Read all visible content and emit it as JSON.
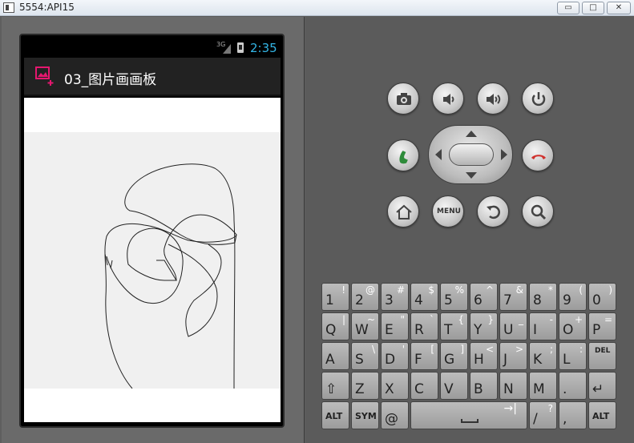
{
  "window": {
    "title": "5554:API15",
    "minimize": "▭",
    "maximize": "□",
    "close": "✕"
  },
  "statusbar": {
    "network": "3G",
    "time": "2:35"
  },
  "app": {
    "title": "03_图片画画板"
  },
  "keyboard": {
    "rows": [
      [
        {
          "m": "1",
          "a": "!"
        },
        {
          "m": "2",
          "a": "@"
        },
        {
          "m": "3",
          "a": "#"
        },
        {
          "m": "4",
          "a": "$"
        },
        {
          "m": "5",
          "a": "%"
        },
        {
          "m": "6",
          "a": "^"
        },
        {
          "m": "7",
          "a": "&"
        },
        {
          "m": "8",
          "a": "*"
        },
        {
          "m": "9",
          "a": "("
        },
        {
          "m": "0",
          "a": ")"
        }
      ],
      [
        {
          "m": "Q",
          "a": "|"
        },
        {
          "m": "W",
          "a": "~"
        },
        {
          "m": "E",
          "a": "\""
        },
        {
          "m": "R",
          "a": "`"
        },
        {
          "m": "T",
          "a": "{"
        },
        {
          "m": "Y",
          "a": "}"
        },
        {
          "m": "U",
          "a": "_"
        },
        {
          "m": "I",
          "a": "-"
        },
        {
          "m": "O",
          "a": "+"
        },
        {
          "m": "P",
          "a": "="
        }
      ],
      [
        {
          "m": "A",
          "a": ""
        },
        {
          "m": "S",
          "a": "\\"
        },
        {
          "m": "D",
          "a": "'"
        },
        {
          "m": "F",
          "a": "["
        },
        {
          "m": "G",
          "a": "]"
        },
        {
          "m": "H",
          "a": "<"
        },
        {
          "m": "J",
          "a": ">"
        },
        {
          "m": "K",
          "a": ";"
        },
        {
          "m": "L",
          "a": ":"
        },
        {
          "m": "DEL",
          "a": ""
        }
      ],
      [
        {
          "m": "⇧",
          "a": ""
        },
        {
          "m": "Z",
          "a": ""
        },
        {
          "m": "X",
          "a": ""
        },
        {
          "m": "C",
          "a": ""
        },
        {
          "m": "V",
          "a": ""
        },
        {
          "m": "B",
          "a": ""
        },
        {
          "m": "N",
          "a": ""
        },
        {
          "m": "M",
          "a": ""
        },
        {
          "m": ".",
          "a": ""
        },
        {
          "m": "↵",
          "a": ""
        }
      ],
      [
        {
          "m": "ALT",
          "a": ""
        },
        {
          "m": "SYM",
          "a": ""
        },
        {
          "m": "@",
          "a": ""
        },
        {
          "m": "SPACE",
          "a": "→|"
        },
        {
          "m": "/",
          "a": "?"
        },
        {
          "m": ",",
          "a": ""
        },
        {
          "m": "ALT",
          "a": ""
        }
      ]
    ]
  },
  "controls": {
    "menu_label": "MENU"
  },
  "colors": {
    "clock": "#33b5e5",
    "app_accent": "#e5176f",
    "call_green": "#2e8b3a",
    "end_red": "#d0312d"
  }
}
